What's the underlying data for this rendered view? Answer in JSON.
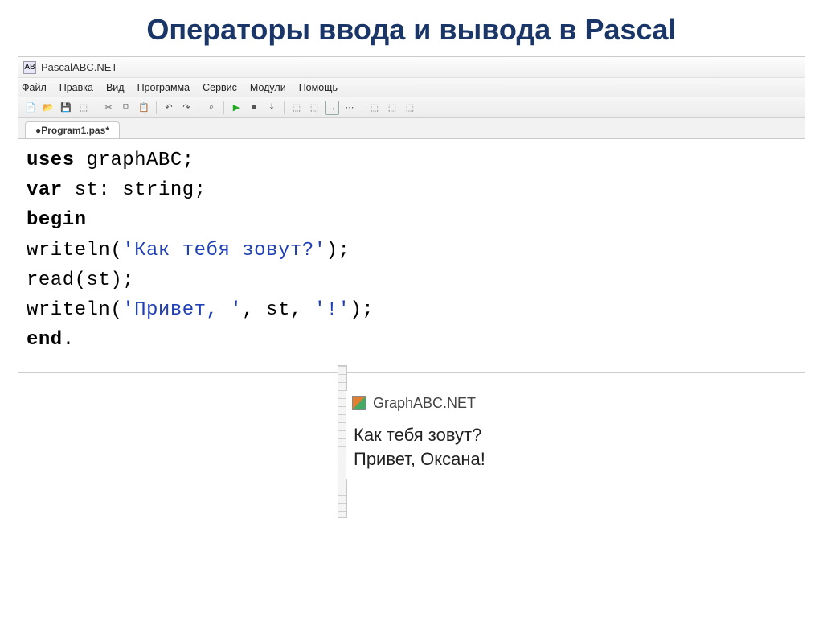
{
  "slide": {
    "title": "Операторы ввода и вывода в Pascal"
  },
  "app": {
    "title": "PascalABC.NET",
    "icon_label": "AB"
  },
  "menu": {
    "items": [
      "Файл",
      "Правка",
      "Вид",
      "Программа",
      "Сервис",
      "Модули",
      "Помощь"
    ]
  },
  "toolbar": {
    "icons": [
      "new",
      "open",
      "save",
      "save-all",
      "cut",
      "copy",
      "paste",
      "undo",
      "redo",
      "find",
      "run",
      "stop",
      "step",
      "step-over",
      "toggle",
      "out1",
      "out2",
      "panel-a",
      "panel-b",
      "panel-c"
    ]
  },
  "tabs": {
    "active": "●Program1.pas*"
  },
  "code": {
    "l1_kw": "uses",
    "l1_rest": " graphABC;",
    "l2_kw": "var",
    "l2_rest": " st: string;",
    "l3_kw": "begin",
    "l4_a": "writeln(",
    "l4_str": "'Как тебя зовут?'",
    "l4_b": ");",
    "l5": "read(st);",
    "l6_a": "writeln(",
    "l6_s1": "'Привет, '",
    "l6_m": ", st, ",
    "l6_s2": "'!'",
    "l6_b": ");",
    "l7_kw": "end",
    "l7_dot": "."
  },
  "popup": {
    "title": "GraphABC.NET",
    "line1": "Как тебя зовут?",
    "line2": "Привет, Оксана!"
  }
}
